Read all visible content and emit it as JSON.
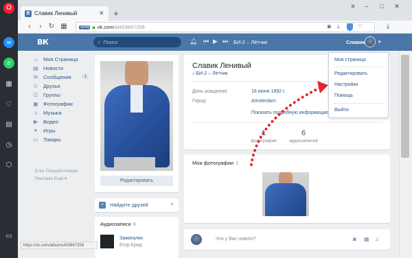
{
  "browser": {
    "tab_title": "Славик Ленивый",
    "tab_favicon": "B",
    "url_badge": "VPN",
    "url_host": "vk.com",
    "url_path": "/id433867259",
    "status_url": "https://vk.com/albums433867259"
  },
  "vk_header": {
    "logo": "ВК",
    "search_placeholder": "Поиск",
    "now_playing": "БИ-2 – Лётчик",
    "user_name": "Славик"
  },
  "sidebar_menu": [
    {
      "label": "Моя Страница",
      "icon": "home-icon"
    },
    {
      "label": "Новости",
      "icon": "news-icon"
    },
    {
      "label": "Сообщения",
      "icon": "messages-icon",
      "count": "1"
    },
    {
      "label": "Друзья",
      "icon": "friends-icon"
    },
    {
      "label": "Группы",
      "icon": "groups-icon"
    },
    {
      "label": "Фотографии",
      "icon": "photos-icon"
    },
    {
      "label": "Музыка",
      "icon": "music-icon"
    },
    {
      "label": "Видео",
      "icon": "video-icon"
    },
    {
      "label": "Игры",
      "icon": "games-icon"
    },
    {
      "label": "Товары",
      "icon": "goods-icon"
    }
  ],
  "sidebar_footer": {
    "line1": "Блог   Разработчикам",
    "line2": "Реклама   Ещё ▾"
  },
  "profile": {
    "name": "Славик Ленивый",
    "status": "♪ БИ-2 – Лётчик",
    "birthday_label": "День рождения:",
    "birthday_value": "18 июня 1992 г.",
    "city_label": "Город:",
    "city_value": "Amsterdam",
    "more_info": "Показать подробную информацию",
    "stats": [
      {
        "number": "1",
        "label": "фотография"
      },
      {
        "number": "6",
        "label": "аудиозаписей"
      }
    ],
    "edit_button": "Редактировать"
  },
  "find_friends": {
    "label": "Найдите друзей"
  },
  "audio": {
    "title": "Аудиозаписи",
    "count": "6",
    "track_name": "Зажигалки",
    "track_artist": "Егор Крид"
  },
  "photos": {
    "title": "Мои фотографии",
    "count": "1"
  },
  "post": {
    "placeholder": "Что у Вас нового?"
  },
  "dropdown": {
    "items": [
      "Моя страница",
      "Редактировать",
      "Настройки",
      "Помощь",
      "Выйти"
    ]
  },
  "colors": {
    "vk_blue": "#4a76a8",
    "arrow_red": "#e3262f",
    "opera_red": "#ff1b2d"
  }
}
